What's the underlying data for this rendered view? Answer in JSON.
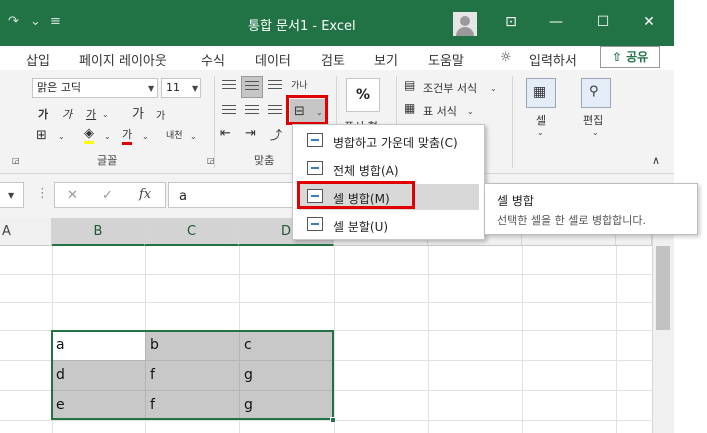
{
  "titlebar": {
    "title": "통합 문서1  -  Excel",
    "redo": "↷",
    "qat_menu": "⌄",
    "colors": {
      "bar": "#217346"
    }
  },
  "tabs": [
    {
      "label": "삽입"
    },
    {
      "label": "페이지 레이아웃"
    },
    {
      "label": "수식"
    },
    {
      "label": "데이터"
    },
    {
      "label": "검토"
    },
    {
      "label": "보기"
    },
    {
      "label": "도움말"
    }
  ],
  "tell_me": "입력하서",
  "share": "공유",
  "font": {
    "name": "맑은 고딕",
    "size": "11",
    "group_label": "글꼴",
    "bold": "가",
    "italic": "가",
    "underline": "가",
    "grow": "가",
    "shrink": "가",
    "font_color": "가",
    "phonetic": "내천"
  },
  "alignment": {
    "group_label": "맞춤",
    "wrap": "가나"
  },
  "number": {
    "percent": "%",
    "label": "표시 형"
  },
  "styles": {
    "conditional": "조건부 서식",
    "format_as_table": "표 서식"
  },
  "cells": {
    "label": "셀"
  },
  "editing": {
    "label": "편집"
  },
  "formula_bar": {
    "cancel": "✕",
    "enter": "✓",
    "fx": "fx",
    "value": "a"
  },
  "grid": {
    "columns": [
      "A",
      "B",
      "C",
      "D"
    ],
    "rows": [
      [
        "a",
        "b",
        "c"
      ],
      [
        "d",
        "f",
        "g"
      ],
      [
        "e",
        "f",
        "g"
      ]
    ]
  },
  "merge_menu": {
    "items": [
      {
        "label": "병합하고 가운데 맞춤(C)"
      },
      {
        "label": "전체 병합(A)"
      },
      {
        "label": "셀 병합(M)"
      },
      {
        "label": "셀 분할(U)"
      }
    ]
  },
  "tooltip": {
    "title": "셀 병합",
    "description": "선택한 셀을 한 셀로 병합합니다."
  }
}
